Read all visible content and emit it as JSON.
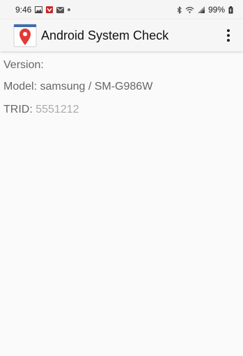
{
  "status_bar": {
    "time": "9:46",
    "battery": "99%",
    "icons_left": [
      "image-icon",
      "app-icon",
      "mail-icon",
      "dot-icon"
    ],
    "icons_right": [
      "bluetooth-icon",
      "wifi-icon",
      "signal-icon",
      "battery-icon"
    ]
  },
  "app_bar": {
    "title": "Android System Check",
    "logo_icon": "map-pin-icon",
    "menu_icon": "overflow-menu-icon"
  },
  "info": {
    "version_label": "Version:",
    "version_value": "",
    "model_text": "Model: samsung / SM-G986W",
    "trid_label": "TRID:",
    "trid_value": "5551212"
  },
  "colors": {
    "accent": "#e53935",
    "logo_bar": "#3d6fb0",
    "text": "#666666",
    "muted": "#aaaaaa"
  }
}
